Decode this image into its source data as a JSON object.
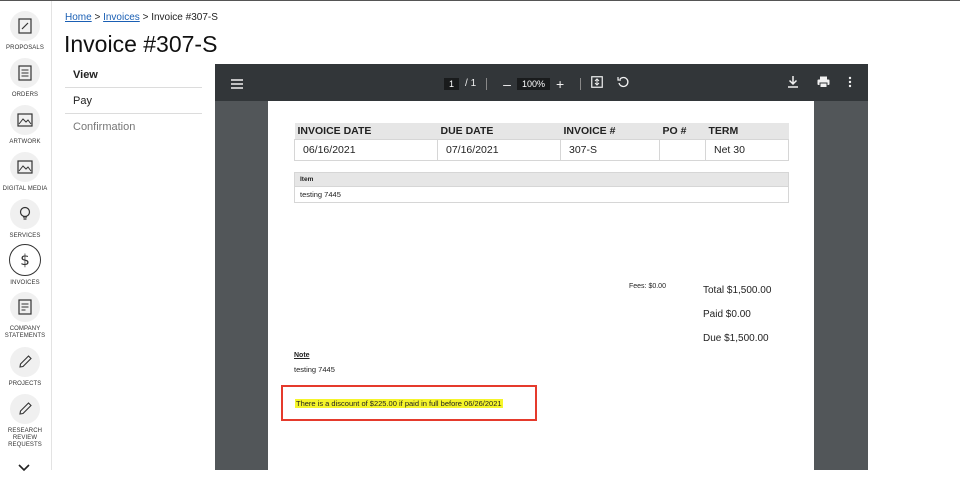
{
  "nav": [
    {
      "label": "PROPOSALS",
      "icon": "proposal-icon"
    },
    {
      "label": "ORDERS",
      "icon": "orders-icon"
    },
    {
      "label": "ARTWORK",
      "icon": "artwork-icon"
    },
    {
      "label": "DIGITAL MEDIA",
      "icon": "digital-media-icon"
    },
    {
      "label": "SERVICES",
      "icon": "lightbulb-icon"
    },
    {
      "label": "INVOICES",
      "icon": "dollar-icon"
    },
    {
      "label": "COMPANY STATEMENTS",
      "icon": "statements-icon"
    },
    {
      "label": "PROJECTS",
      "icon": "pencil-icon"
    },
    {
      "label": "RESEARCH REVIEW REQUESTS",
      "icon": "pencil-icon"
    }
  ],
  "breadcrumb": {
    "home": "Home",
    "invoices": "Invoices",
    "sep": ">",
    "current": "Invoice #307-S"
  },
  "page_title": "Invoice #307-S",
  "tabs": {
    "view": "View",
    "pay": "Pay",
    "confirmation": "Confirmation"
  },
  "viewer": {
    "page_current": "1",
    "page_total": "/ 1",
    "zoom": "100%",
    "zoom_out": "–",
    "zoom_in": "+"
  },
  "invoice": {
    "headers": {
      "date": "INVOICE DATE",
      "due": "DUE DATE",
      "number": "INVOICE #",
      "po": "PO #",
      "term": "TERM"
    },
    "values": {
      "date": "06/16/2021",
      "due": "07/16/2021",
      "number": "307-S",
      "po": "",
      "term": "Net 30"
    },
    "item_header": "Item",
    "item_value": "testing 7445",
    "fees": "Fees: $0.00",
    "total": "Total $1,500.00",
    "paid": "Paid $0.00",
    "due_amount": "Due $1,500.00",
    "note_title": "Note",
    "note_text": "testing 7445",
    "discount": "There is a discount of $225.00 if paid in full before 06/26/2021"
  },
  "colors": {
    "accent_link": "#1a5fb4",
    "highlight": "#f5f52a",
    "annotation_border": "#e53a2c",
    "toolbar": "#323639"
  }
}
